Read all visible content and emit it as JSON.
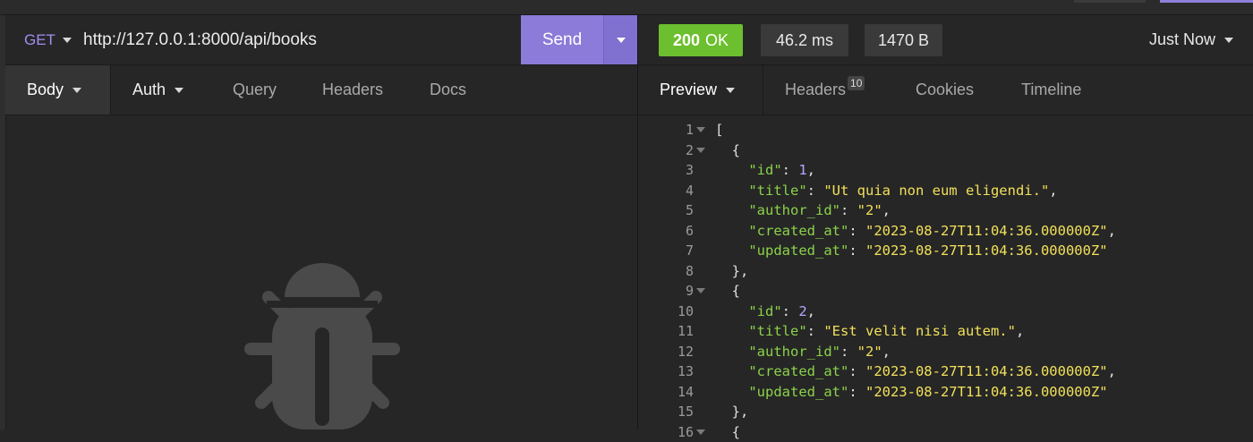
{
  "request": {
    "method": "GET",
    "url": "http://127.0.0.1:8000/api/books",
    "send_label": "Send",
    "tabs": [
      "Body",
      "Auth",
      "Query",
      "Headers",
      "Docs"
    ]
  },
  "response": {
    "status_code": "200",
    "status_text": "OK",
    "time": "46.2 ms",
    "size": "1470 B",
    "history_label": "Just Now",
    "tabs": {
      "preview": "Preview",
      "headers": "Headers",
      "headers_count": "10",
      "cookies": "Cookies",
      "timeline": "Timeline"
    },
    "lines": [
      {
        "n": "1",
        "fold": true,
        "indent": "",
        "tokens": [
          [
            "p",
            "["
          ]
        ]
      },
      {
        "n": "2",
        "fold": true,
        "indent": "  ",
        "tokens": [
          [
            "p",
            "{"
          ]
        ]
      },
      {
        "n": "3",
        "fold": false,
        "indent": "    ",
        "tokens": [
          [
            "k",
            "\"id\""
          ],
          [
            "p",
            ": "
          ],
          [
            "n",
            "1"
          ],
          [
            "p",
            ","
          ]
        ]
      },
      {
        "n": "4",
        "fold": false,
        "indent": "    ",
        "tokens": [
          [
            "k",
            "\"title\""
          ],
          [
            "p",
            ": "
          ],
          [
            "s",
            "\"Ut quia non eum eligendi.\""
          ],
          [
            "p",
            ","
          ]
        ]
      },
      {
        "n": "5",
        "fold": false,
        "indent": "    ",
        "tokens": [
          [
            "k",
            "\"author_id\""
          ],
          [
            "p",
            ": "
          ],
          [
            "s",
            "\"2\""
          ],
          [
            "p",
            ","
          ]
        ]
      },
      {
        "n": "6",
        "fold": false,
        "indent": "    ",
        "tokens": [
          [
            "k",
            "\"created_at\""
          ],
          [
            "p",
            ": "
          ],
          [
            "s",
            "\"2023-08-27T11:04:36.000000Z\""
          ],
          [
            "p",
            ","
          ]
        ]
      },
      {
        "n": "7",
        "fold": false,
        "indent": "    ",
        "tokens": [
          [
            "k",
            "\"updated_at\""
          ],
          [
            "p",
            ": "
          ],
          [
            "s",
            "\"2023-08-27T11:04:36.000000Z\""
          ]
        ]
      },
      {
        "n": "8",
        "fold": false,
        "indent": "  ",
        "tokens": [
          [
            "p",
            "},"
          ]
        ]
      },
      {
        "n": "9",
        "fold": true,
        "indent": "  ",
        "tokens": [
          [
            "p",
            "{"
          ]
        ]
      },
      {
        "n": "10",
        "fold": false,
        "indent": "    ",
        "tokens": [
          [
            "k",
            "\"id\""
          ],
          [
            "p",
            ": "
          ],
          [
            "n",
            "2"
          ],
          [
            "p",
            ","
          ]
        ]
      },
      {
        "n": "11",
        "fold": false,
        "indent": "    ",
        "tokens": [
          [
            "k",
            "\"title\""
          ],
          [
            "p",
            ": "
          ],
          [
            "s",
            "\"Est velit nisi autem.\""
          ],
          [
            "p",
            ","
          ]
        ]
      },
      {
        "n": "12",
        "fold": false,
        "indent": "    ",
        "tokens": [
          [
            "k",
            "\"author_id\""
          ],
          [
            "p",
            ": "
          ],
          [
            "s",
            "\"2\""
          ],
          [
            "p",
            ","
          ]
        ]
      },
      {
        "n": "13",
        "fold": false,
        "indent": "    ",
        "tokens": [
          [
            "k",
            "\"created_at\""
          ],
          [
            "p",
            ": "
          ],
          [
            "s",
            "\"2023-08-27T11:04:36.000000Z\""
          ],
          [
            "p",
            ","
          ]
        ]
      },
      {
        "n": "14",
        "fold": false,
        "indent": "    ",
        "tokens": [
          [
            "k",
            "\"updated_at\""
          ],
          [
            "p",
            ": "
          ],
          [
            "s",
            "\"2023-08-27T11:04:36.000000Z\""
          ]
        ]
      },
      {
        "n": "15",
        "fold": false,
        "indent": "  ",
        "tokens": [
          [
            "p",
            "},"
          ]
        ]
      },
      {
        "n": "16",
        "fold": true,
        "indent": "  ",
        "tokens": [
          [
            "p",
            "{"
          ]
        ]
      }
    ]
  },
  "colors": {
    "accent": "#8c7bd8",
    "status_ok": "#6cbf2e",
    "json_key": "#8bd24a",
    "json_string": "#f1e05a",
    "json_number": "#b9a6ff"
  },
  "icons": {
    "empty_state": "bug-icon"
  }
}
